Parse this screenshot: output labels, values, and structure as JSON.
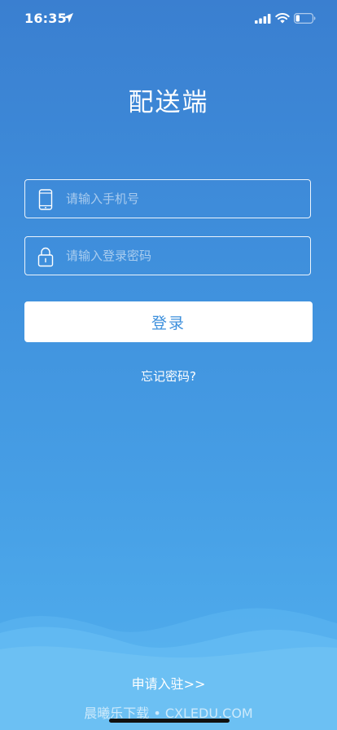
{
  "status_bar": {
    "time": "16:35",
    "location_icon": "location-arrow-icon",
    "signal_icon": "cellular-signal-icon",
    "wifi_icon": "wifi-icon",
    "battery_icon": "battery-low-icon"
  },
  "title": "配送端",
  "phone_field": {
    "placeholder": "请输入手机号",
    "value": "",
    "icon": "phone-icon"
  },
  "password_field": {
    "placeholder": "请输入登录密码",
    "value": "",
    "icon": "lock-icon"
  },
  "login_button": {
    "label": "登录"
  },
  "forgot_password": {
    "label": "忘记密码?"
  },
  "apply_link": {
    "label": "申请入驻>>"
  },
  "watermark": {
    "text": "晨曦乐下载 • CXLEDU.COM"
  },
  "colors": {
    "background_top": "#3a7fd0",
    "background_bottom": "#52b0ee",
    "button_text": "#3c8fdc",
    "wave_light": "#6cc0f3"
  }
}
